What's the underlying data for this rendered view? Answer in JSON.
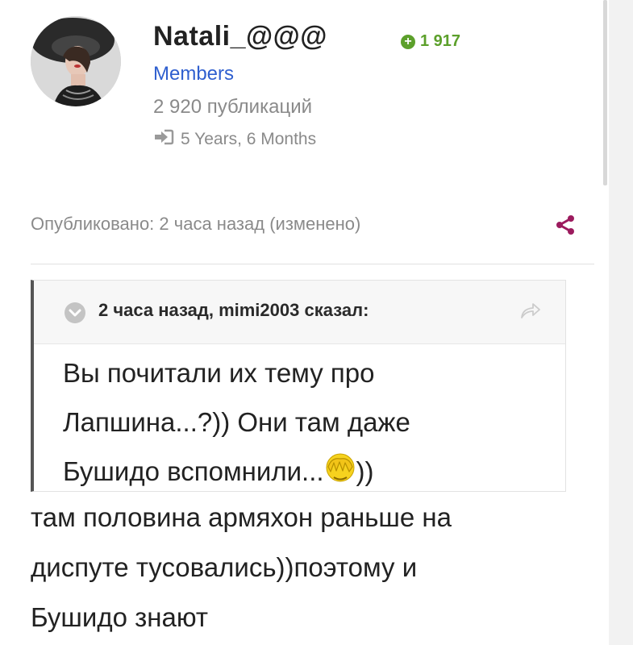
{
  "profile": {
    "username": "Natali_@@@",
    "reputation": "1 917",
    "group": "Members",
    "post_count": "2 920 публикаций",
    "membership": "5 Years, 6 Months"
  },
  "post": {
    "posted_label": "Опубликовано: 2 часа назад (изменено)",
    "quote": {
      "header": "2 часа назад, mimi2003 сказал:",
      "line1": "Вы почитали их тему про",
      "line2": "Лапшина...?)) Они там даже",
      "line3_text": "Бушидо вспомнили...",
      "line3_suffix": "))"
    },
    "reply_line1": "там половина армяхон раньше на",
    "reply_line2": "диспуте тусовались))поэтому и",
    "reply_line3": "Бушидо знают"
  },
  "icons": {
    "reputation": "plus-circle-icon",
    "joined": "sign-in-icon",
    "share": "share-icon",
    "quote_toggle": "chevron-down-icon",
    "quote_jump": "share-arrow-icon",
    "emoji": "facepalm-emoji-icon"
  },
  "colors": {
    "username": "#222222",
    "reputation": "#5ca02b",
    "group_link": "#2f5fcf",
    "meta_text": "#8a8a8a",
    "share_icon": "#9c1b5e",
    "quote_border": "#555555"
  }
}
